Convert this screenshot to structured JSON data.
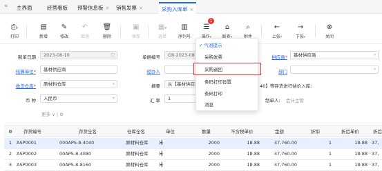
{
  "tabs": {
    "collapse_icon": "double-chevron-left-icon",
    "items": [
      {
        "label": "主界面",
        "closable": false
      },
      {
        "label": "经营看板",
        "closable": false
      },
      {
        "label": "预警信息板",
        "closable": true
      },
      {
        "label": "销售发票",
        "closable": true
      },
      {
        "label": "采购入库单",
        "closable": true,
        "active": true
      }
    ],
    "close_symbol": "×"
  },
  "toolbar": {
    "print": "打印",
    "new": "新增",
    "edit": "修改",
    "cancel": "取消",
    "delete": "删除",
    "save": "保存",
    "select_order": "选单",
    "serial": "序列号",
    "operate": "操作",
    "operate_badge": "1",
    "associate": "联查",
    "attachment": "附件",
    "prev": "上张",
    "next": "下张",
    "close": "关闭"
  },
  "menu": {
    "items": [
      "气泡提示",
      "采购发票",
      "采购退回",
      "条码打印设置",
      "条码打印",
      "消息"
    ],
    "checked_index": 0,
    "highlighted": "采购退回"
  },
  "form": {
    "doc_date_label": "制单日期",
    "doc_date": "2023-08-10",
    "doc_no_label": "单据编号",
    "doc_no": "GR-2023-08",
    "supplier_label": "供应商",
    "supplier": "基材供应商",
    "settle_unit_label": "结算单位",
    "settle_unit": "基材供应商",
    "handler_label": "经办人",
    "dept_label": "部门",
    "warehouse_label": "收货仓库",
    "warehouse": "原材料仓库",
    "summary_label": "摘要",
    "summary_left": "从【基材供应商",
    "summary_right": "40】等存货进行估价入库;",
    "currency_label": "币 种",
    "currency": "人民币",
    "rate_label": "汇 率",
    "rate": "1",
    "maker_label": "制单人:",
    "maker": "会计主管",
    "more": "更多"
  },
  "grid": {
    "headers": [
      "存货编号",
      "存货全名",
      "仓库全名",
      "单位",
      "数量",
      "不含税单价",
      "金额",
      "折扣",
      "折后单价",
      "折后"
    ],
    "rows": [
      {
        "no": "1",
        "code": "ASP0001",
        "name": "000APS-8-4040",
        "warehouse": "原材料仓库",
        "unit": "米",
        "qty": "2000",
        "price": "18.88",
        "amount": "37,760.00",
        "discount": "1",
        "disc_price": "18.88",
        "disc_amount": "37,"
      },
      {
        "no": "2",
        "code": "ASP0002",
        "name": "00APS-8-4080",
        "warehouse": "原材料仓库",
        "unit": "米",
        "qty": "2000",
        "price": "18.88",
        "amount": "37,760.00",
        "discount": "1",
        "disc_price": "18.88",
        "disc_amount": "37,"
      },
      {
        "no": "3",
        "code": "ASP0003",
        "name": "00APS-8-8160",
        "warehouse": "原材料仓库",
        "unit": "米",
        "qty": "2000",
        "price": "18.88",
        "amount": "37,760.00",
        "discount": "1",
        "disc_price": "18.88",
        "disc_amount": "37,"
      }
    ]
  },
  "colors": {
    "accent": "#2468f2",
    "highlight": "#e53935",
    "selected_row": "#e8efff"
  }
}
